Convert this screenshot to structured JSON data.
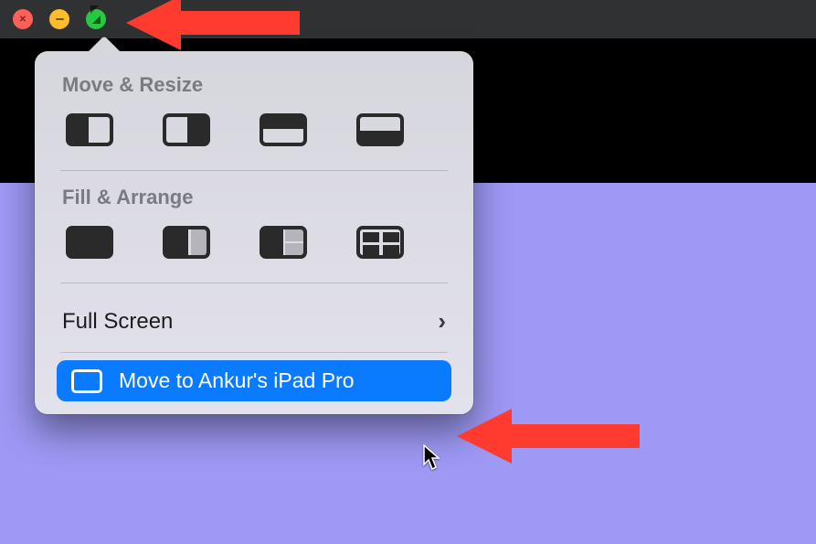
{
  "traffic": {
    "close": "close-button",
    "minimize": "minimize-button",
    "zoom": "zoom-button"
  },
  "popover": {
    "section_move_resize": "Move & Resize",
    "section_fill_arrange": "Fill & Arrange",
    "full_screen_label": "Full Screen",
    "move_to_device_label": "Move to Ankur's iPad Pro"
  },
  "icons": {
    "tile_left": "tile-left",
    "tile_right": "tile-right",
    "tile_top": "tile-top",
    "tile_bottom": "tile-bottom",
    "fill_full": "fill-full",
    "fill_left_big": "fill-left-two-thirds",
    "fill_quarter": "fill-left-quarters",
    "fill_quad": "fill-quadrants"
  }
}
